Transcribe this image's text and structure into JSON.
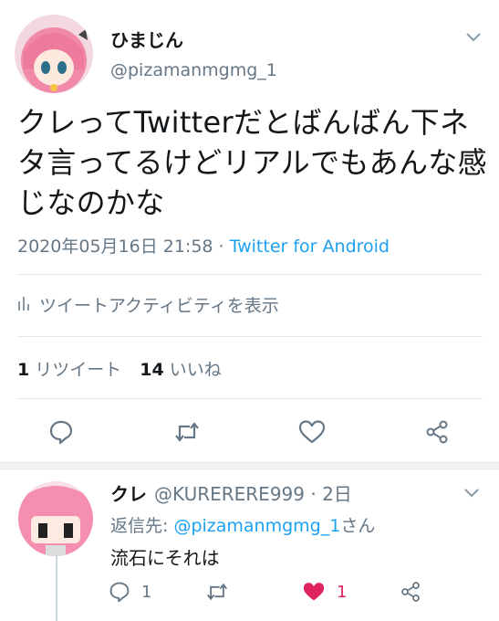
{
  "tweet": {
    "display_name": "ひまじん",
    "handle": "@pizamanmgmg_1",
    "text": "クレってTwitterだとばんばん下ネタ言ってるけどリアルでもあんな感じなのかな",
    "date": "2020年05月16日 21:58",
    "separator": " · ",
    "source": "Twitter for Android",
    "activity_label": "ツイートアクティビティを表示",
    "retweet_count": "1",
    "retweet_label": "リツイート",
    "like_count": "14",
    "like_label": "いいね"
  },
  "reply": {
    "display_name": "クレ",
    "handle": "@KURERERE999",
    "time": " · 2日",
    "reply_prefix": "返信先: ",
    "reply_mention": "@pizamanmgmg_1",
    "reply_suffix": "さん",
    "text": "流石にそれは",
    "reply_count": "1",
    "retweet_count": "",
    "like_count": "1"
  },
  "icons": {
    "chevron": "chevron-down-icon",
    "activity": "bar-chart-icon",
    "reply": "speech-bubble-icon",
    "retweet": "retweet-icon",
    "like": "heart-icon",
    "share": "share-icon"
  },
  "colors": {
    "accent": "#1da1f2",
    "muted": "#657786",
    "like": "#e0245e",
    "text": "#14171a"
  }
}
